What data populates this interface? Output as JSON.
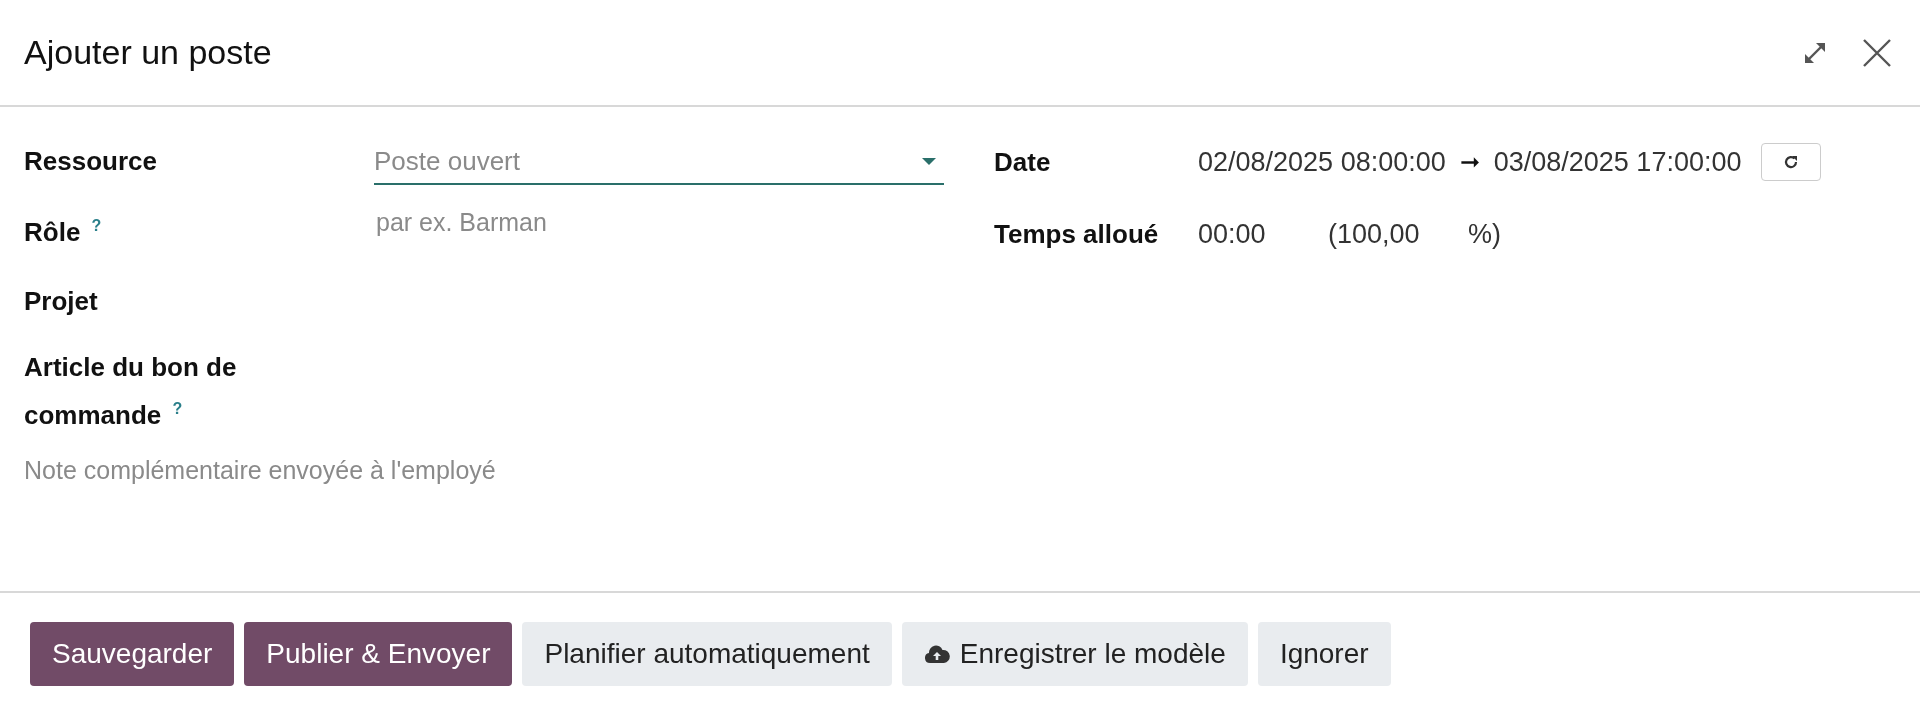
{
  "dialog": {
    "title": "Ajouter un poste"
  },
  "left_fields": [
    {
      "label": "Ressource",
      "kind": "select",
      "placeholder": "Poste ouvert"
    },
    {
      "label": "Rôle $^{?}$",
      "kind": "input",
      "placeholder": "par ex. Barman"
    },
    {
      "label": "Projet",
      "kind": "empty"
    },
    {
      "label": "Article du bon de commande $^{?}$",
      "kind": "empty"
    }
  ],
  "note": {
    "placeholder": "Note complémentaire envoyée à l'employé"
  },
  "date": {
    "label": "Date",
    "start": "02/08/2025 08:00:00",
    "arrow": "➞",
    "end": "03/08/2025 17:00:00"
  },
  "allocated": {
    "label": "Temps alloué",
    "hours": "00:00",
    "percent": "(100,00",
    "percent_sign": "%)"
  },
  "buttons": [
    {
      "label": "Sauvegarder",
      "kind": "primary"
    },
    {
      "label": "Publier & Envoyer",
      "kind": "primary"
    },
    {
      "label": "Planifier automatiquement",
      "kind": "secondary"
    },
    {
      "label": "Enregistrer le modèle",
      "kind": "upload"
    },
    {
      "label": "Ignorer",
      "kind": "secondary"
    }
  ]
}
